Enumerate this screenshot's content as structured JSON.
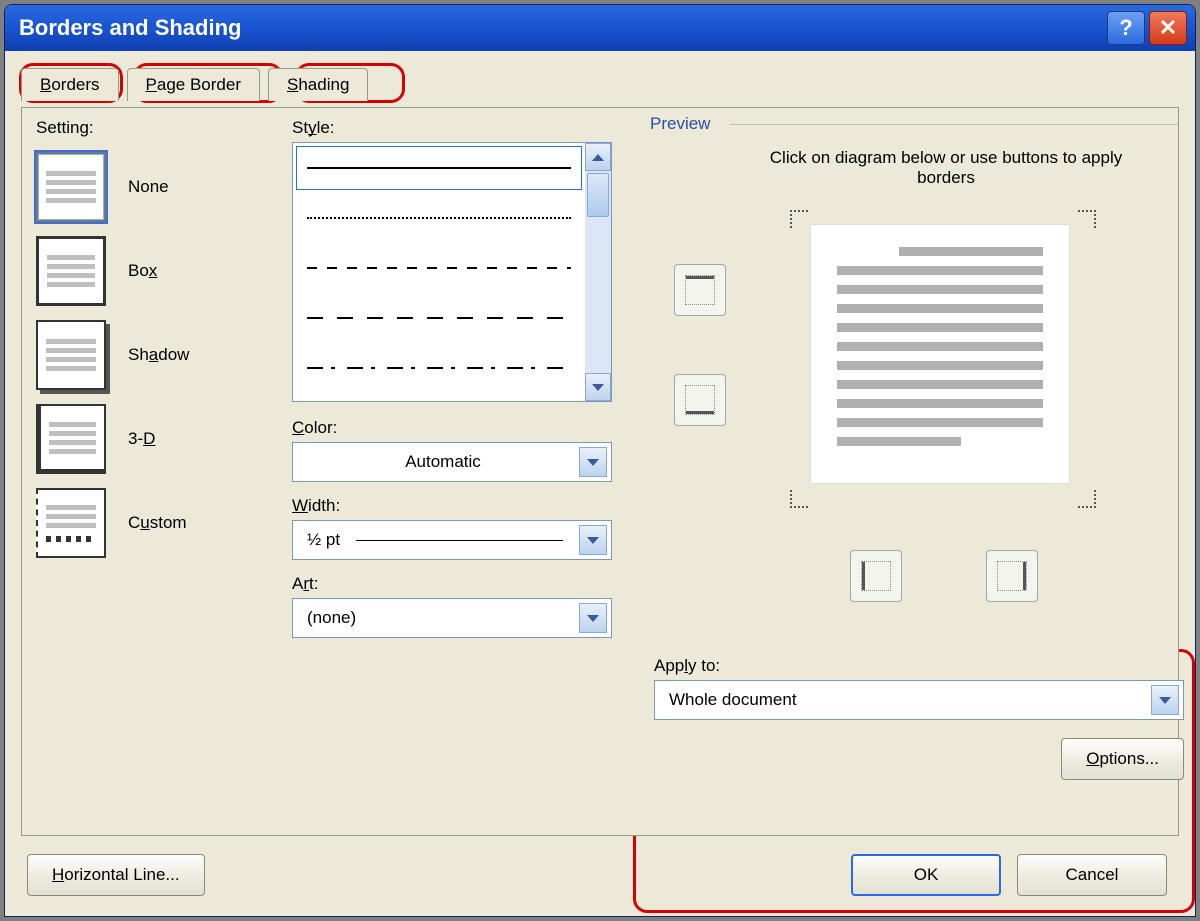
{
  "window": {
    "title": "Borders and Shading"
  },
  "tabs": {
    "borders": "Borders",
    "page_border": "Page Border",
    "shading": "Shading"
  },
  "setting": {
    "label": "Setting:",
    "items": [
      {
        "label": "None"
      },
      {
        "label": "Box"
      },
      {
        "label": "Shadow"
      },
      {
        "label": "3-D"
      },
      {
        "label": "Custom"
      }
    ]
  },
  "style": {
    "label": "Style:",
    "color_label": "Color:",
    "color_value": "Automatic",
    "width_label": "Width:",
    "width_value": "½ pt",
    "art_label": "Art:",
    "art_value": "(none)"
  },
  "preview": {
    "label": "Preview",
    "hint": "Click on diagram below or use buttons to apply borders"
  },
  "apply": {
    "label": "Apply to:",
    "value": "Whole document",
    "options_btn": "Options..."
  },
  "buttons": {
    "hline": "Horizontal Line...",
    "ok": "OK",
    "cancel": "Cancel"
  }
}
